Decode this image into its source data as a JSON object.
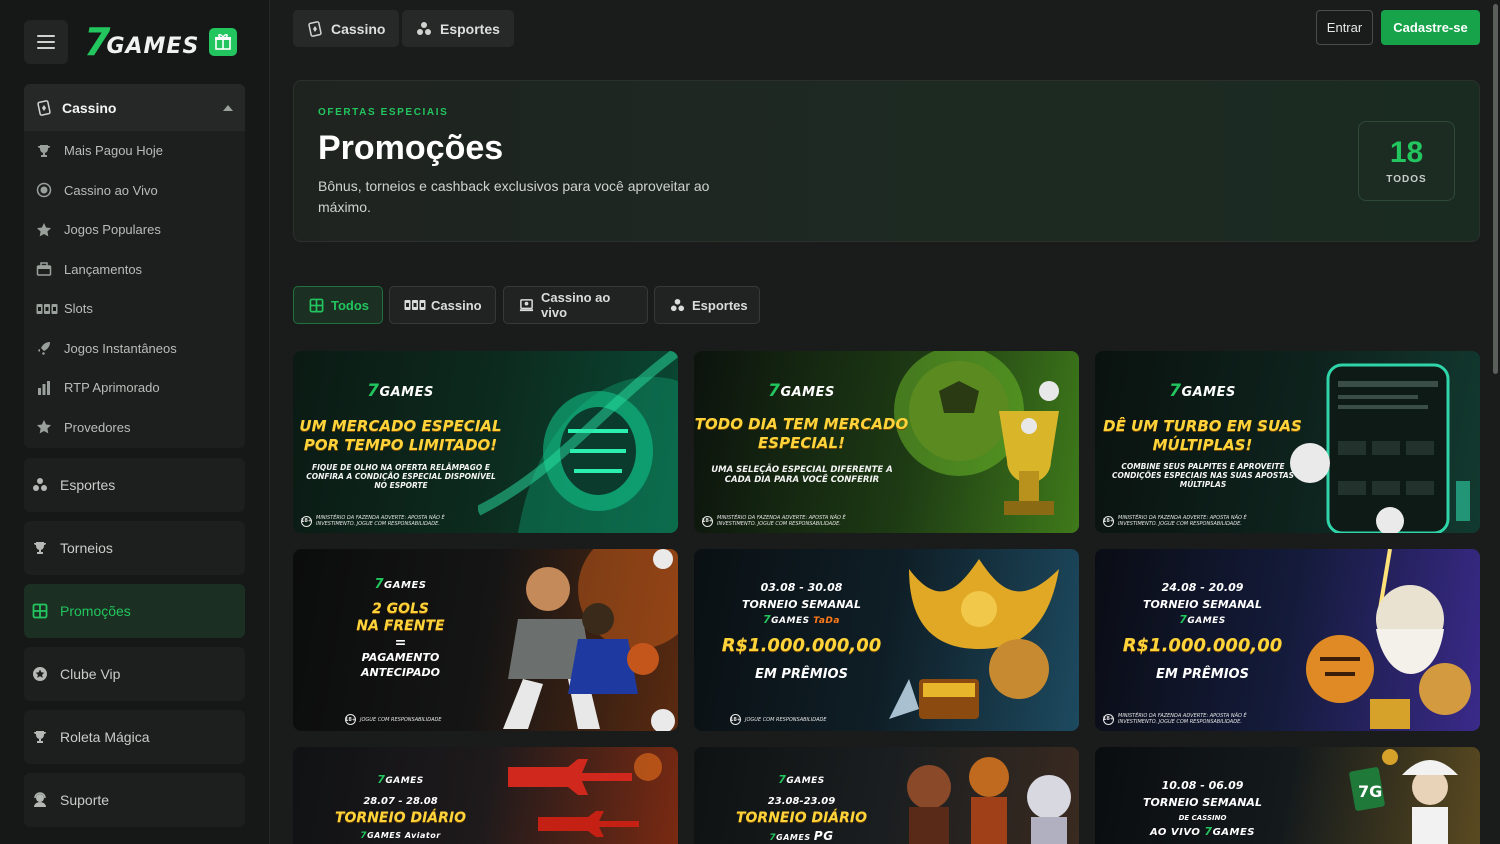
{
  "sidebar": {
    "logo_seven": "7",
    "logo_word": "GAMES",
    "cassino_label": "Cassino",
    "cassino_items": [
      {
        "label": "Mais Pagou Hoje",
        "icon": "trophy-icon"
      },
      {
        "label": "Cassino ao Vivo",
        "icon": "live-icon"
      },
      {
        "label": "Jogos Populares",
        "icon": "star-icon"
      },
      {
        "label": "Lançamentos",
        "icon": "gift-box-icon"
      },
      {
        "label": "Slots",
        "icon": "slots-icon"
      },
      {
        "label": "Jogos Instantâneos",
        "icon": "rocket-icon"
      },
      {
        "label": "RTP Aprimorado",
        "icon": "bar-chart-icon"
      },
      {
        "label": "Provedores",
        "icon": "star-icon"
      }
    ],
    "esportes": "Esportes",
    "torneios": "Torneios",
    "promocoes": "Promoções",
    "clube_vip": "Clube Vip",
    "roleta": "Roleta Mágica",
    "suporte": "Suporte"
  },
  "topbar": {
    "cassino": "Cassino",
    "esportes": "Esportes",
    "entrar": "Entrar",
    "cadastro": "Cadastre-se"
  },
  "hero": {
    "eyebrow": "OFERTAS ESPECIAIS",
    "title": "Promoções",
    "description": "Bônus, torneios e cashback exclusivos para você aproveitar ao máximo.",
    "count": "18",
    "count_label": "TODOS"
  },
  "filters": {
    "todos": "Todos",
    "cassino": "Cassino",
    "cassino_vivo": "Cassino ao vivo",
    "esportes": "Esportes"
  },
  "colors": {
    "accent": "#22c55e",
    "background": "#1a1c1b",
    "sidebar": "#161817"
  },
  "cards": {
    "brand": "GAMES",
    "c1": {
      "headline": "UM MERCADO ESPECIAL POR TEMPO LIMITADO!",
      "sub": "FIQUE DE OLHO NA OFERTA RELÂMPAGO E CONFIRA A CONDIÇÃO ESPECIAL DISPONÍVEL NO ESPORTE",
      "footer": "MINISTÉRIO DA FAZENDA ADVERTE: APOSTA NÃO É INVESTIMENTO. JOGUE COM RESPONSABILIDADE."
    },
    "c2": {
      "headline": "TODO DIA TEM MERCADO ESPECIAL!",
      "sub": "UMA SELEÇÃO ESPECIAL DIFERENTE A CADA DIA PARA VOCÊ CONFERIR",
      "footer": "MINISTÉRIO DA FAZENDA ADVERTE: APOSTA NÃO É INVESTIMENTO. JOGUE COM RESPONSABILIDADE."
    },
    "c3": {
      "headline": "DÊ UM TURBO EM SUAS MÚLTIPLAS!",
      "sub": "COMBINE SEUS PALPITES E APROVEITE CONDIÇÕES ESPECIAIS NAS SUAS APOSTAS MÚLTIPLAS",
      "footer": "MINISTÉRIO DA FAZENDA ADVERTE: APOSTA NÃO É INVESTIMENTO. JOGUE COM RESPONSABILIDADE."
    },
    "c4": {
      "line1": "2 GOLS",
      "line2": "NA FRENTE",
      "equals": "=",
      "line3": "PAGAMENTO",
      "line4": "ANTECIPADO",
      "footer": "JOGUE COM RESPONSABILIDADE"
    },
    "c5": {
      "date": "03.08 - 30.08",
      "tourney": "TORNEIO SEMANAL",
      "partner": "TaDa",
      "prize": "R$1.000.000,00",
      "em": "EM PRÊMIOS",
      "footer": "JOGUE COM RESPONSABILIDADE"
    },
    "c6": {
      "date": "24.08 - 20.09",
      "tourney": "TORNEIO SEMANAL",
      "prize": "R$1.000.000,00",
      "em": "EM PRÊMIOS",
      "footer": "MINISTÉRIO DA FAZENDA ADVERTE: APOSTA NÃO É INVESTIMENTO. JOGUE COM RESPONSABILIDADE."
    },
    "c7": {
      "date": "28.07 - 28.08",
      "tourney": "TORNEIO DIÁRIO",
      "partner": "Aviator"
    },
    "c8": {
      "date": "23.08-23.09",
      "tourney": "TORNEIO DIÁRIO",
      "partner": "PG"
    },
    "c9": {
      "date": "10.08 - 06.09",
      "tourney": "TORNEIO SEMANAL",
      "sub": "DE CASSINO",
      "line": "AO VIVO"
    }
  }
}
